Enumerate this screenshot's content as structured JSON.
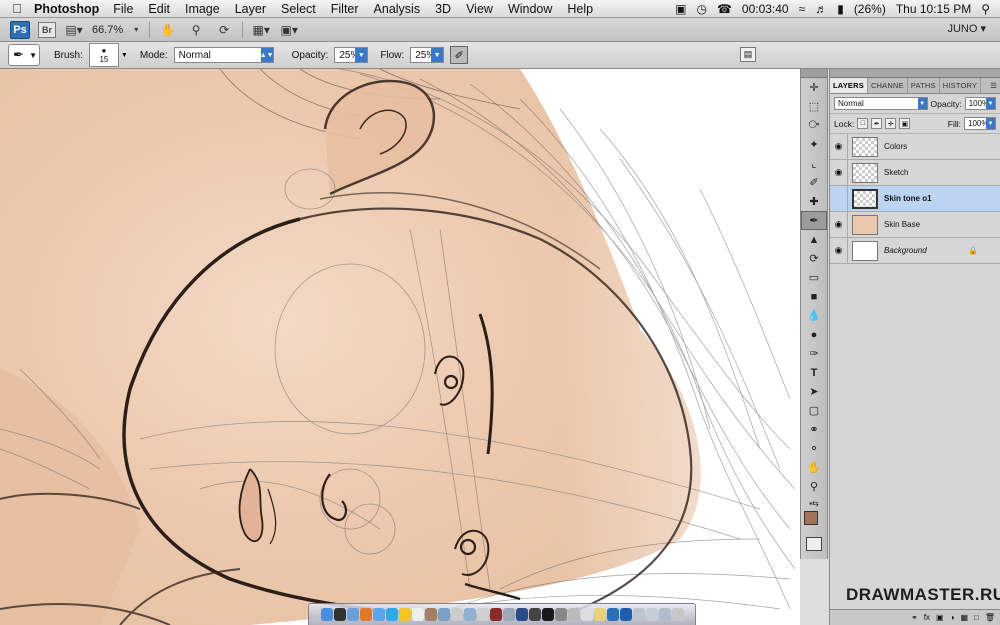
{
  "menubar": {
    "app_name": "Photoshop",
    "menus": [
      "File",
      "Edit",
      "Image",
      "Layer",
      "Select",
      "Filter",
      "Analysis",
      "3D",
      "View",
      "Window",
      "Help"
    ],
    "status": {
      "timer": "00:03:40",
      "battery": "(26%)",
      "clock": "Thu 10:15 PM"
    }
  },
  "appbar": {
    "ps_label": "Ps",
    "br_label": "Br",
    "zoom": "66.7%",
    "workspace": "JUNO"
  },
  "options": {
    "brush_label": "Brush:",
    "brush_size": "15",
    "mode_label": "Mode:",
    "mode_value": "Normal",
    "opacity_label": "Opacity:",
    "opacity_value": "25%",
    "flow_label": "Flow:",
    "flow_value": "25%"
  },
  "layers_panel": {
    "tabs": [
      "LAYERS",
      "CHANNE",
      "PATHS",
      "HISTORY"
    ],
    "blend_mode": "Normal",
    "opacity_label": "Opacity:",
    "opacity_value": "100%",
    "lock_label": "Lock:",
    "fill_label": "Fill:",
    "fill_value": "100%",
    "layers": [
      {
        "name": "Colors",
        "thumb": "transparent",
        "selected": false
      },
      {
        "name": "Sketch",
        "thumb": "transparent",
        "selected": false
      },
      {
        "name": "Skin tone o1",
        "thumb": "transparent",
        "selected": true
      },
      {
        "name": "Skin Base",
        "thumb": "skin",
        "selected": false
      },
      {
        "name": "Background",
        "thumb": "white",
        "selected": false,
        "locked": true
      }
    ]
  },
  "colors": {
    "foreground": "#a57357",
    "background": "#ffffff",
    "skin": "#ecc9ae",
    "selection": "#bcd4f2"
  },
  "watermark": "DRAWMASTER.RU"
}
